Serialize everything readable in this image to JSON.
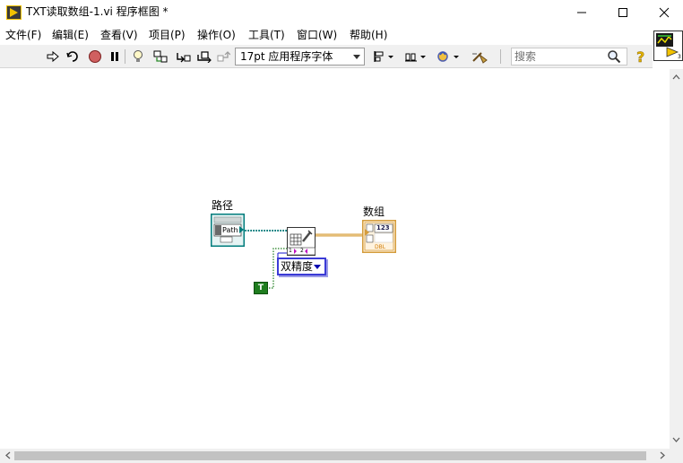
{
  "window": {
    "title": "TXT读取数组-1.vi 程序框图 *"
  },
  "menu": {
    "items": [
      "文件(F)",
      "编辑(E)",
      "查看(V)",
      "项目(P)",
      "操作(O)",
      "工具(T)",
      "窗口(W)",
      "帮助(H)"
    ]
  },
  "toolbar": {
    "font_select": "17pt 应用程序字体",
    "search_placeholder": "搜索",
    "icons": [
      "run-arrow-icon",
      "run-continuously-icon",
      "abort-icon",
      "pause-icon",
      "highlight-execution-icon",
      "retain-wire-values-icon",
      "step-into-icon",
      "step-over-icon",
      "step-out-icon",
      "align-objects-icon",
      "distribute-objects-icon",
      "reorder-icon",
      "clean-up-icon",
      "search-icon",
      "help-icon"
    ]
  },
  "diagram": {
    "path_control_label": "路径",
    "path_terminal_text": "Path",
    "array_indicator_label": "数组",
    "array_terminal_text": "123",
    "array_terminal_type": "DBL",
    "function_node_terminals": [
      "1",
      "2"
    ],
    "enum_ring_value": "双精度",
    "bool_constant_value": "T"
  },
  "colors": {
    "path_wire": "#007c7c",
    "double_wire": "#d49c3c",
    "boolean_wire": "#1f7d1f",
    "enum_border": "#3b3bd6"
  }
}
